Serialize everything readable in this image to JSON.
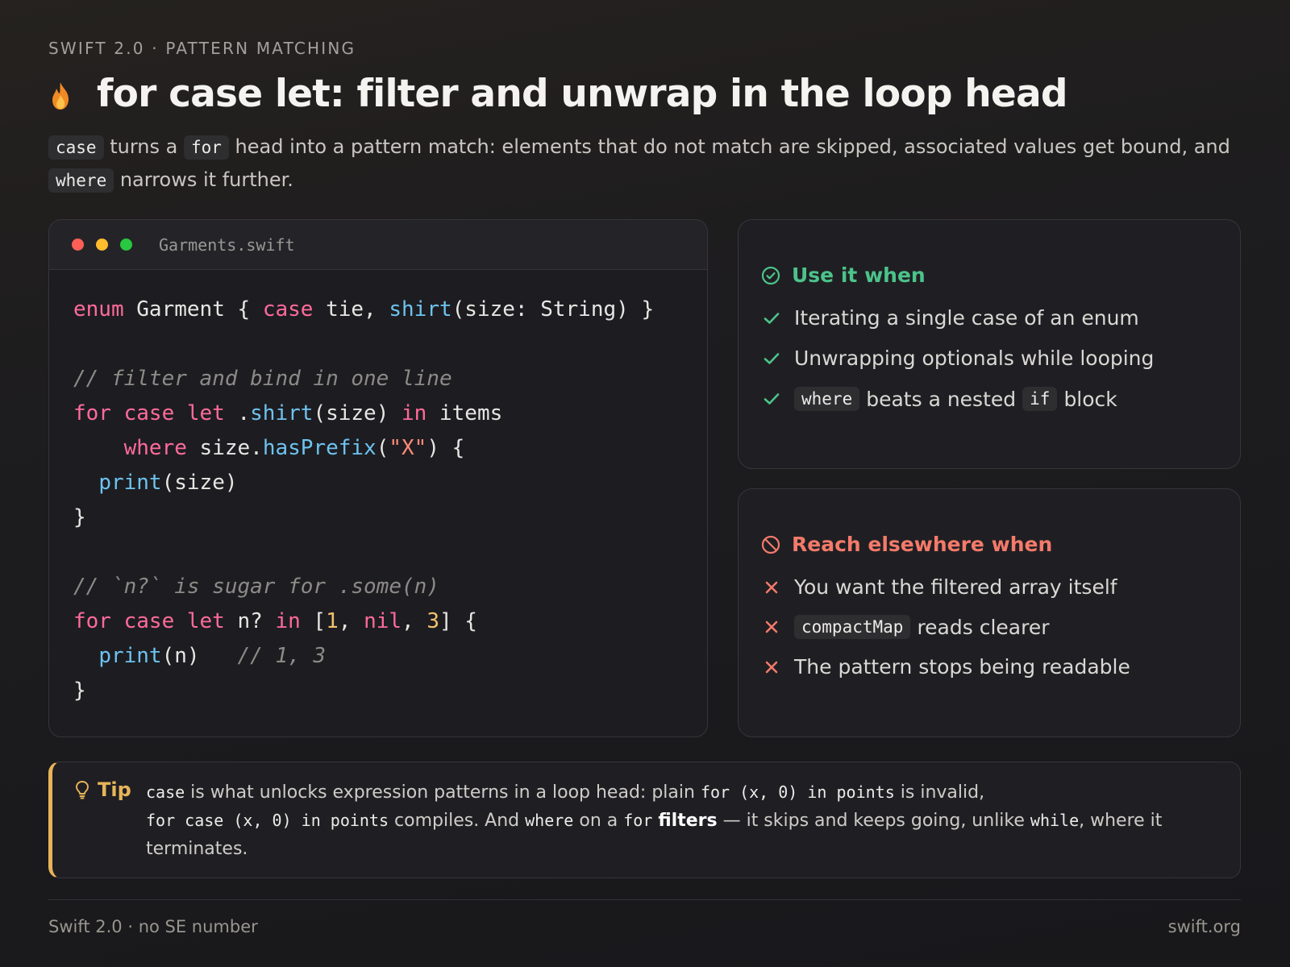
{
  "eyebrow": "SWIFT 2.0 · PATTERN MATCHING",
  "title_icon": "flame-icon",
  "title": "for case let: filter and unwrap in the loop head",
  "lede": {
    "code1": "case",
    "t1": " turns a ",
    "code2": "for",
    "t2": " head into a pattern match: elements that do not match are skipped, associated values get bound, and ",
    "code3": "where",
    "t3": " narrows it further."
  },
  "editor": {
    "filename": "Garments.swift",
    "window_dots": [
      "#ff5f57",
      "#febc2e",
      "#28c840"
    ]
  },
  "use_card": {
    "heading": "Use it when",
    "icon": "check-circle-icon",
    "color": "#4cc38a",
    "items": [
      {
        "text": "Iterating a single case of an enum"
      },
      {
        "text": "Unwrapping optionals while looping"
      },
      {
        "code": "where",
        "text": "beats a nested",
        "code2": "if",
        "text2": "block"
      }
    ]
  },
  "avoid_card": {
    "heading": "Reach elsewhere when",
    "icon": "prohibited-icon",
    "color": "#f47a6a",
    "items": [
      {
        "text": "You want the filtered array itself"
      },
      {
        "code": "compactMap",
        "text": "reads clearer"
      },
      {
        "text": "The pattern stops being readable"
      }
    ]
  },
  "tip": {
    "label": "Tip",
    "icon": "lightbulb-icon",
    "accent": "#e7b45a",
    "c1": "case",
    "t1": " is what unlocks expression patterns in a loop head: plain ",
    "c2": "for (x, 0) in points",
    "t2": " is invalid, ",
    "c3": "for case (x, 0) in points",
    "t3": " compiles. And ",
    "c4": "where",
    "t4": " on a ",
    "c5": "for",
    "t5": " ",
    "bold": "filters",
    "t6": " — it skips and keeps going, unlike ",
    "c6": "while",
    "t7": ", where it terminates."
  },
  "footer": {
    "left": "Swift 2.0 · no SE number",
    "right": "swift.org"
  }
}
